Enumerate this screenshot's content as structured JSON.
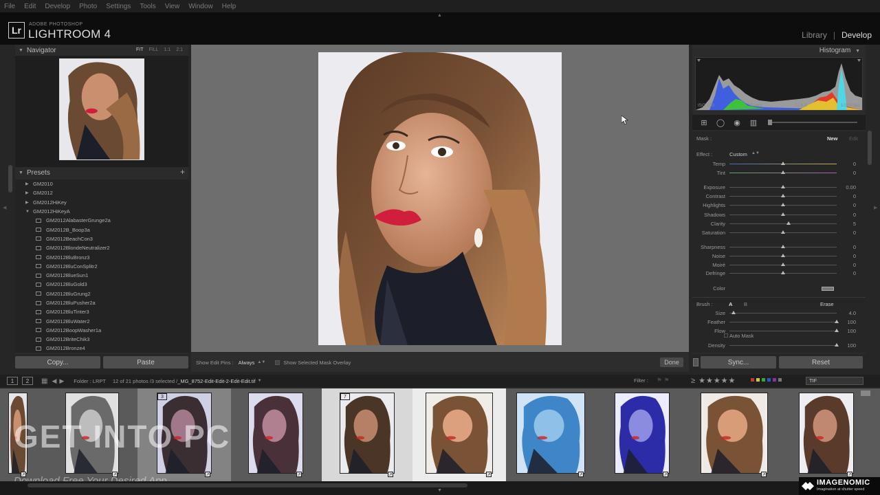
{
  "menu": [
    "File",
    "Edit",
    "Develop",
    "Photo",
    "Settings",
    "Tools",
    "View",
    "Window",
    "Help"
  ],
  "identity": {
    "logo": "Lr",
    "subtitle": "ADOBE PHOTOSHOP",
    "title": "LIGHTROOM 4"
  },
  "modules": {
    "library": "Library",
    "separator": "|",
    "develop": "Develop"
  },
  "navigator": {
    "title": "Navigator",
    "options": [
      "FIT",
      "FILL",
      "1:1",
      "2:1"
    ]
  },
  "presets": {
    "title": "Presets",
    "plus": "+",
    "folders": [
      {
        "label": "GM2010",
        "open": false
      },
      {
        "label": "GM2012",
        "open": false
      },
      {
        "label": "GM2012HiKey",
        "open": false
      },
      {
        "label": "GM2012HiKeyA",
        "open": true
      }
    ],
    "items": [
      "GM2012AlabasterGrunge2a",
      "GM2012B_Boop3a",
      "GM2012BeachCon3",
      "GM2012BlondeNeutralizer2",
      "GM2012BluBronz3",
      "GM2012BluConSplitr2",
      "GM2012BlueSun1",
      "GM2012BluGold3",
      "GM2012BluGrung2",
      "GM2012BluPusher2a",
      "GM2012BluTinter3",
      "GM2012BluWater2",
      "GM2012BoopWasher1a",
      "GM2012BriteChik3",
      "GM2012Bronze4"
    ]
  },
  "left_buttons": {
    "copy": "Copy...",
    "paste": "Paste"
  },
  "toolbar": {
    "show_pins_label": "Show Edit Pins :",
    "show_pins_value": "Always",
    "overlay_label": "Show Selected Mask Overlay",
    "done": "Done"
  },
  "histogram": {
    "title": "Histogram",
    "iso": "ISO 100",
    "focal": "50 mm",
    "aperture": "f / 6.3",
    "shutter": "1/200 sec"
  },
  "adjust": {
    "mask_label": "Mask :",
    "mask_new": "New",
    "mask_edit": "Edit",
    "effect_label": "Effect :",
    "effect_value": "Custom",
    "sliders_a": [
      {
        "label": "Temp",
        "value": "0",
        "amount": 0
      },
      {
        "label": "Tint",
        "value": "0",
        "amount": 0
      }
    ],
    "sliders_b": [
      {
        "label": "Exposure",
        "value": "0.00",
        "amount": 0
      },
      {
        "label": "Contrast",
        "value": "0",
        "amount": 0
      },
      {
        "label": "Highlights",
        "value": "0",
        "amount": 0
      },
      {
        "label": "Shadows",
        "value": "0",
        "amount": 0
      },
      {
        "label": "Clarity",
        "value": "5",
        "amount": 5
      },
      {
        "label": "Saturation",
        "value": "0",
        "amount": 0
      }
    ],
    "sliders_c": [
      {
        "label": "Sharpness",
        "value": "0",
        "amount": 0
      },
      {
        "label": "Noise",
        "value": "0",
        "amount": 0
      },
      {
        "label": "Moiré",
        "value": "0",
        "amount": 0
      },
      {
        "label": "Defringe",
        "value": "0",
        "amount": 0
      }
    ],
    "color_label": "Color",
    "brush_label": "Brush :",
    "brush_a": "A",
    "brush_b": "B",
    "brush_erase": "Erase",
    "brush_sliders": [
      {
        "label": "Size",
        "value": "4.0",
        "fraction": 0.04
      },
      {
        "label": "Feather",
        "value": "100",
        "fraction": 1.0
      },
      {
        "label": "Flow",
        "value": "100",
        "fraction": 1.0
      }
    ],
    "auto_mask": "Auto Mask",
    "density": {
      "label": "Density",
      "value": "100",
      "fraction": 1.0
    }
  },
  "right_buttons": {
    "sync": "Sync...",
    "reset": "Reset"
  },
  "filmbar": {
    "view1": "1",
    "view2": "2",
    "folder": "Folder : LRPT",
    "count": "12 of 21 photos /3 selected /",
    "file": "_MG_8752-Edit-Edit-2-Edit-Edit.tif",
    "filter_label": "Filter :",
    "stars": "≥ ★★★★★",
    "format": "TIF"
  },
  "filmstrip": {
    "badges": [
      "3",
      "7"
    ]
  },
  "watermark": {
    "main": "GET INTO PC",
    "sub": "Download Free Your Desired App"
  },
  "imagenomic": {
    "title": "IMAGENOMIC",
    "tagline": "Imagination at shutter speed"
  },
  "colors": {
    "accent_lips": "#d11e3c",
    "panel_bg": "#2b2b2b",
    "center_bg": "#6e6e6e"
  }
}
